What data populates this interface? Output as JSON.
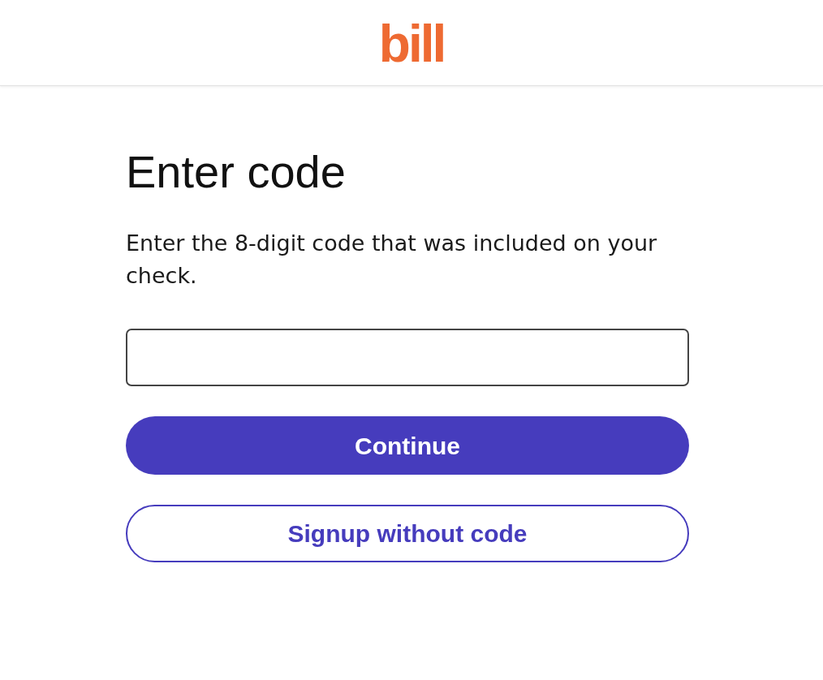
{
  "header": {
    "logo": "bill"
  },
  "heading": "Enter code",
  "description": "Enter the 8-digit code that was included on your check.",
  "buttons": [
    {
      "label": "Continue",
      "kind": "primary"
    },
    {
      "label": "Signup without code",
      "kind": "secondary"
    }
  ]
}
